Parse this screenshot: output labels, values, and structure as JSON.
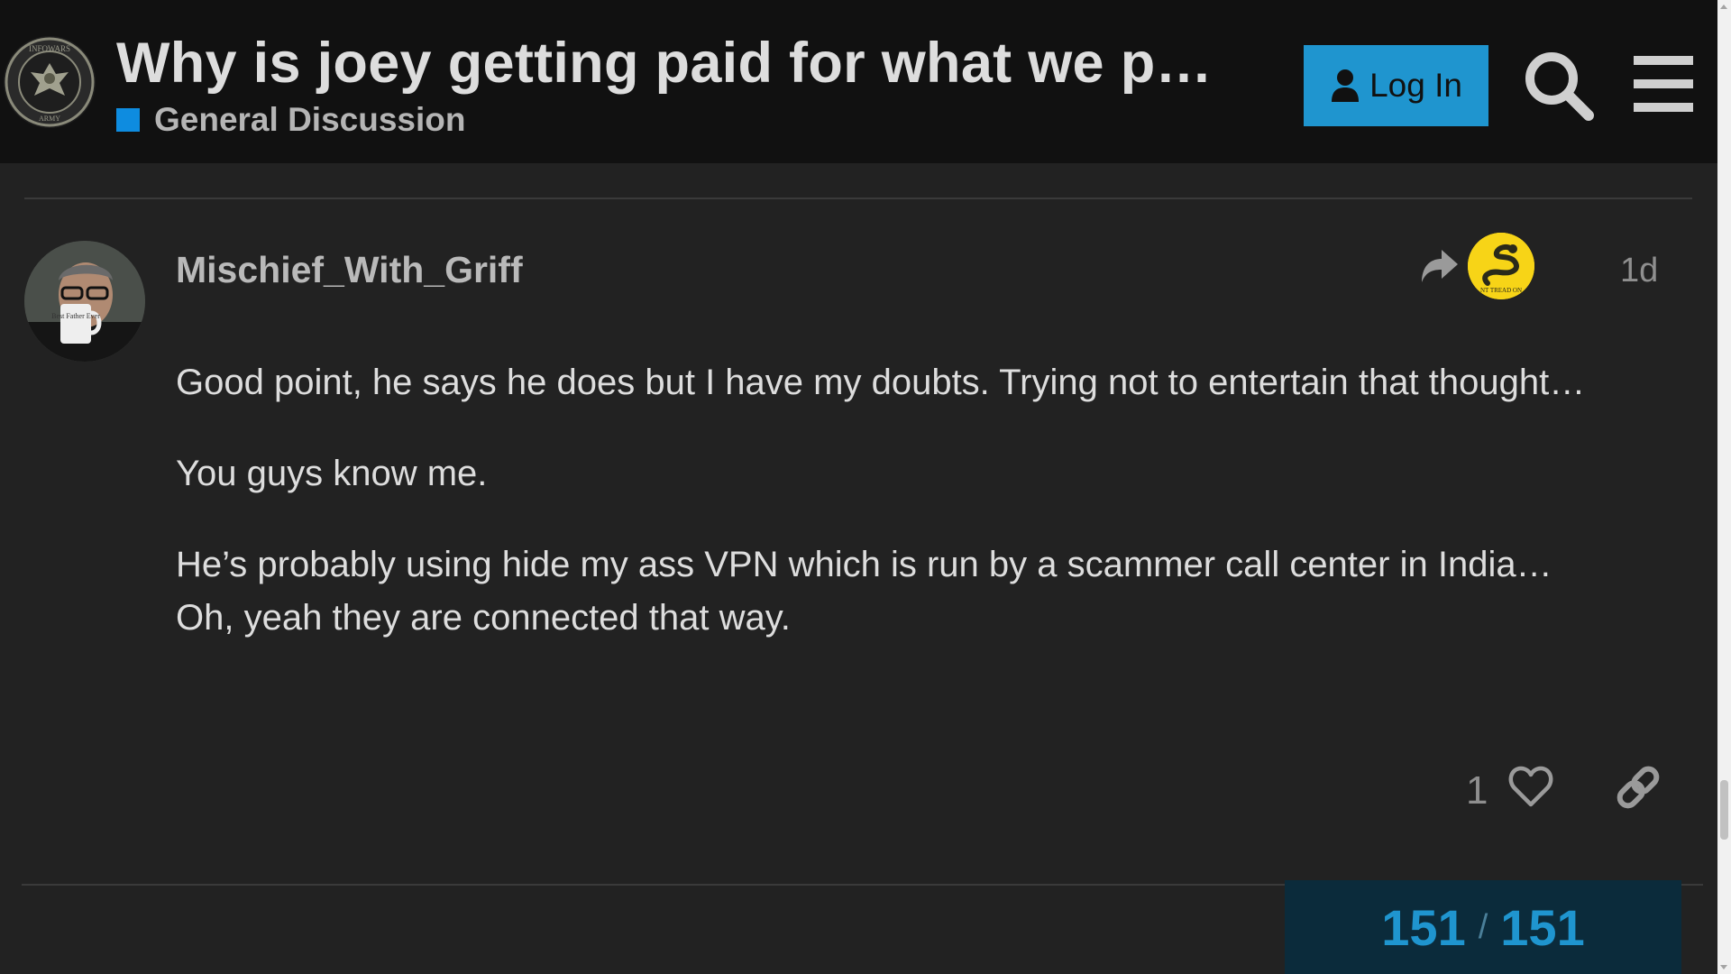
{
  "header": {
    "title": "Why is joey getting paid for what we p…",
    "category": "General Discussion",
    "login_label": "Log In",
    "logo_text_top": "INFOWARS",
    "logo_text_bottom": "ARMY"
  },
  "post": {
    "username": "Mischief_With_Griff",
    "date": "1d",
    "flair_text": "NT TREAD ON",
    "paragraphs": [
      "Good point, he says he does but I have my doubts. Trying not to entertain that thought…",
      "You guys know me.",
      "He’s probably using hide my ass VPN which is run by a scammer call center in India…",
      "Oh, yeah they are connected that way."
    ],
    "like_count": "1",
    "mug_text": "Best Father Ever"
  },
  "timeline": {
    "current": "151",
    "separator": "/",
    "total": "151"
  },
  "colors": {
    "header_bg": "#111111",
    "page_bg": "#222222",
    "accent": "#1f95cf",
    "category_swatch": "#0e8ce0",
    "flair_bg": "#f7d417",
    "timeline_bg": "#0b2b3b"
  },
  "icons": {
    "login": "user-icon",
    "search": "search-icon",
    "menu": "hamburger-icon",
    "reply": "reply-arrow-icon",
    "like": "heart-icon",
    "link": "link-icon"
  }
}
